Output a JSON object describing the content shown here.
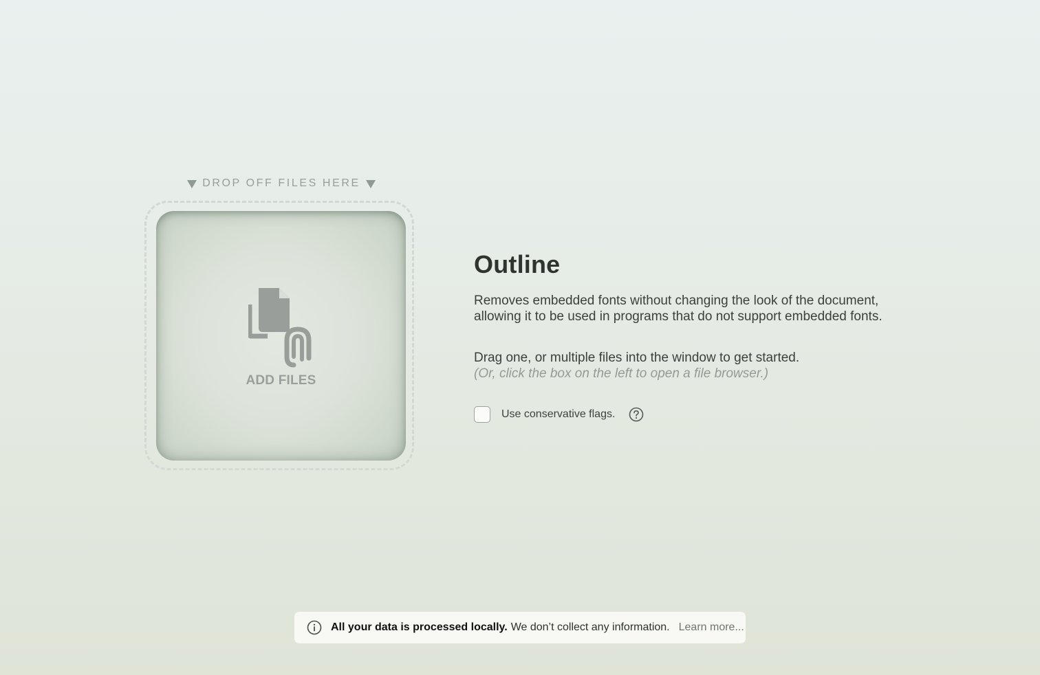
{
  "dropzone": {
    "hint": "DROP OFF FILES HERE",
    "add_label": "ADD FILES",
    "icons": {
      "hint_left": "down-triangle",
      "hint_right": "down-triangle",
      "add": "files-with-paperclip"
    }
  },
  "tool": {
    "title": "Outline",
    "description": "Removes embedded fonts without changing the look of the document, allowing it to be used in programs that do not support embedded fonts.",
    "instruction": "Drag one, or multiple files into the window to get started.",
    "instruction_hint": "(Or, click the box on the left to open a file browser.)"
  },
  "options": {
    "conservative_label": "Use conservative flags.",
    "conservative_checked": false,
    "help_icon": "question-circle"
  },
  "notice": {
    "icon": "info-circle",
    "bold": "All your data is processed locally.",
    "text": "We don’t collect any information.",
    "link": "Learn more..."
  },
  "colors": {
    "background_top": "#eaf0ef",
    "background_bottom": "#dfe4d7",
    "title": "#2f3430",
    "muted": "#949a95",
    "notice_bg": "#f8f9f4"
  }
}
